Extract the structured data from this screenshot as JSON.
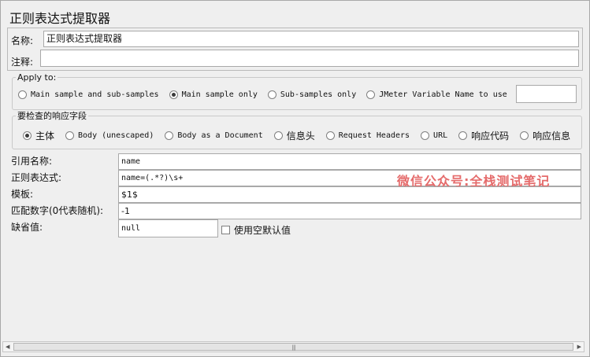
{
  "panel_title": "正则表达式提取器",
  "name_label": "名称:",
  "name_value": "正则表达式提取器",
  "comment_label": "注释:",
  "apply_to": {
    "legend": "Apply to:",
    "options": [
      "Main sample and sub-samples",
      "Main sample only",
      "Sub-samples only",
      "JMeter Variable Name to use"
    ],
    "selected": "Main sample only",
    "variable_value": ""
  },
  "field_to_check": {
    "legend": "要检查的响应字段",
    "options": [
      "主体",
      "Body (unescaped)",
      "Body as a Document",
      "信息头",
      "Request Headers",
      "URL",
      "响应代码",
      "响应信息"
    ],
    "selected": "主体"
  },
  "ref_name_label": "引用名称:",
  "ref_name_value": "name",
  "regex_label": "正则表达式:",
  "regex_value": "name=(.*?)\\s+",
  "template_label": "模板:",
  "template_value": "$1$",
  "match_no_label": "匹配数字(0代表随机):",
  "match_no_value": "-1",
  "default_label": "缺省值:",
  "default_value": "null",
  "empty_default_label": "使用空默认值",
  "empty_default_checked": false,
  "watermark": "微信公众号:全栈测试笔记",
  "icons": {
    "scroll_left": "triangle-left",
    "scroll_right": "triangle-right",
    "scroll_grip": "grip-lines"
  }
}
